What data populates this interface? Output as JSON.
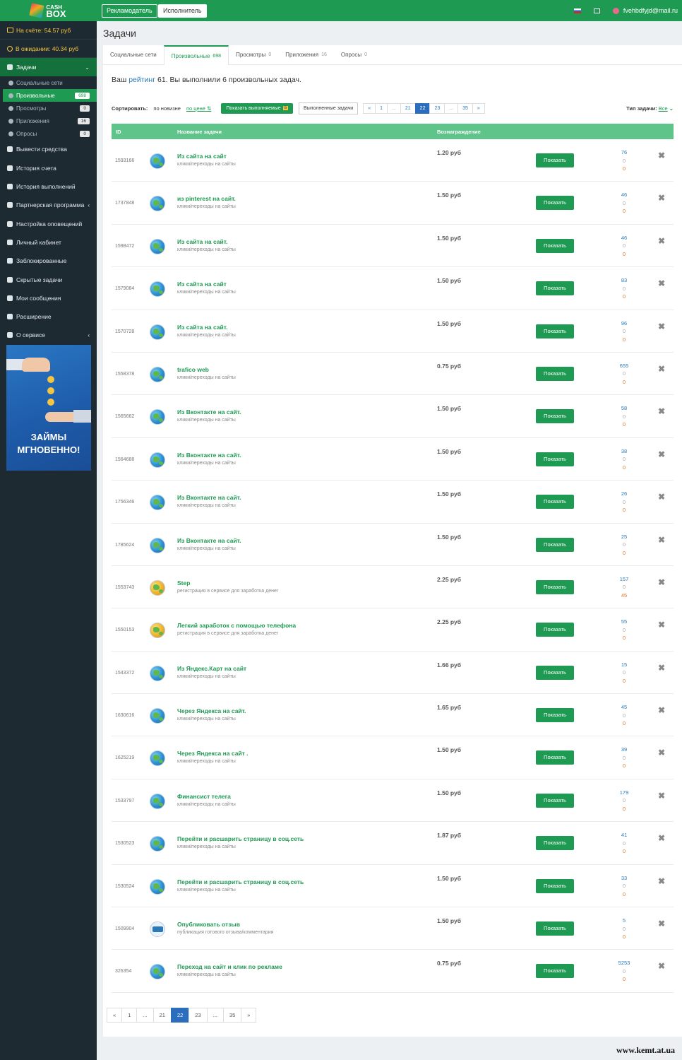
{
  "logo": {
    "line1": "CASH",
    "line2": "BOX"
  },
  "header": {
    "advertiser_label": "Рекламодатель",
    "executor_label": "Исполнитель",
    "user_email": "fvehbdfyjd@mail.ru"
  },
  "sidebar": {
    "balance": "На счёте: 54.57 руб",
    "pending": "В ожидании: 40.34 руб",
    "tasks_label": "Задачи",
    "sub_items": [
      {
        "label": "Социальные сети",
        "badge": ""
      },
      {
        "label": "Произвольные",
        "badge": "698"
      },
      {
        "label": "Просмотры",
        "badge": "0"
      },
      {
        "label": "Приложения",
        "badge": "16"
      },
      {
        "label": "Опросы",
        "badge": "0"
      }
    ],
    "items": [
      "Вывести средства",
      "История счета",
      "История выполнений",
      "Партнерская программа",
      "Настройка оповещений",
      "Личный кабинет",
      "Заблокированные",
      "Скрытые задачи",
      "Мои сообщения",
      "Расширение",
      "О сервисе"
    ],
    "banner_text_1": "ЗАЙМЫ",
    "banner_text_2": "МГНОВЕННО!"
  },
  "page": {
    "title": "Задачи"
  },
  "tabs": [
    {
      "label": "Социальные сети",
      "count": ""
    },
    {
      "label": "Произвольные",
      "count": "698"
    },
    {
      "label": "Просмотры",
      "count": "0"
    },
    {
      "label": "Приложения",
      "count": "16"
    },
    {
      "label": "Опросы",
      "count": "0"
    }
  ],
  "rating": {
    "prefix": "Ваш",
    "link": "рейтинг",
    "suffix": "61. Вы выполнили 6 произвольных задач."
  },
  "controls": {
    "sort_label": "Сортировать:",
    "sort_new": "по новизне",
    "sort_price": "по цене",
    "show_done_label": "Показать выполняемые",
    "show_done_badge": "6",
    "completed_label": "Выполненные задачи",
    "task_type_label": "Тип задачи:",
    "task_type_value": "Все"
  },
  "pagination": [
    "«",
    "1",
    "...",
    "21",
    "22",
    "23",
    "...",
    "35",
    "»"
  ],
  "pagination_current": "22",
  "table": {
    "headers": {
      "id": "ID",
      "name": "Название задачи",
      "reward": "Вознаграждение"
    },
    "show_label": "Показать",
    "rows": [
      {
        "id": "1593166",
        "title": "Из сайта на сайт",
        "cat": "клики/переходы на сайты",
        "price": "1.20 руб",
        "s1": "76",
        "s2": "0",
        "s3": "0",
        "icon": "globe"
      },
      {
        "id": "1737848",
        "title": "из pinterest на сайт.",
        "cat": "клики/переходы на сайты",
        "price": "1.50 руб",
        "s1": "46",
        "s2": "0",
        "s3": "0",
        "icon": "globe"
      },
      {
        "id": "1598472",
        "title": "Из сайта на сайт.",
        "cat": "клики/переходы на сайты",
        "price": "1.50 руб",
        "s1": "46",
        "s2": "0",
        "s3": "0",
        "icon": "globe"
      },
      {
        "id": "1579084",
        "title": "Из сайта на сайт",
        "cat": "клики/переходы на сайты",
        "price": "1.50 руб",
        "s1": "83",
        "s2": "0",
        "s3": "0",
        "icon": "globe"
      },
      {
        "id": "1570728",
        "title": "Из сайта на сайт.",
        "cat": "клики/переходы на сайты",
        "price": "1.50 руб",
        "s1": "96",
        "s2": "0",
        "s3": "0",
        "icon": "globe"
      },
      {
        "id": "1558378",
        "title": "trafico web",
        "cat": "клики/переходы на сайты",
        "price": "0.75 руб",
        "s1": "655",
        "s2": "0",
        "s3": "0",
        "icon": "globe"
      },
      {
        "id": "1565662",
        "title": "Из Вконтакте на сайт.",
        "cat": "клики/переходы на сайты",
        "price": "1.50 руб",
        "s1": "58",
        "s2": "0",
        "s3": "0",
        "icon": "globe"
      },
      {
        "id": "1564688",
        "title": "Из Вконтакте на сайт.",
        "cat": "клики/переходы на сайты",
        "price": "1.50 руб",
        "s1": "38",
        "s2": "0",
        "s3": "0",
        "icon": "globe"
      },
      {
        "id": "1756346",
        "title": "Из Вконтакте на сайт.",
        "cat": "клики/переходы на сайты",
        "price": "1.50 руб",
        "s1": "26",
        "s2": "0",
        "s3": "0",
        "icon": "globe"
      },
      {
        "id": "1785624",
        "title": "Из Вконтакте на сайт.",
        "cat": "клики/переходы на сайты",
        "price": "1.50 руб",
        "s1": "25",
        "s2": "0",
        "s3": "0",
        "icon": "globe"
      },
      {
        "id": "1553743",
        "title": "Step",
        "cat": "регистрация в сервисе для заработка денег",
        "price": "2.25 руб",
        "s1": "157",
        "s2": "0",
        "s3": "45",
        "icon": "reg"
      },
      {
        "id": "1550153",
        "title": "Легкий заработок с помощью телефона",
        "cat": "регистрация в сервисе для заработка денег",
        "price": "2.25 руб",
        "s1": "55",
        "s2": "0",
        "s3": "0",
        "icon": "reg"
      },
      {
        "id": "1543372",
        "title": "Из Яндекс.Карт на сайт",
        "cat": "клики/переходы на сайты",
        "price": "1.66 руб",
        "s1": "15",
        "s2": "0",
        "s3": "0",
        "icon": "globe"
      },
      {
        "id": "1630616",
        "title": "Через Яндекса на сайт.",
        "cat": "клики/переходы на сайты",
        "price": "1.65 руб",
        "s1": "45",
        "s2": "0",
        "s3": "0",
        "icon": "globe"
      },
      {
        "id": "1625219",
        "title": "Через Яндекса на сайт .",
        "cat": "клики/переходы на сайты",
        "price": "1.50 руб",
        "s1": "39",
        "s2": "0",
        "s3": "0",
        "icon": "globe"
      },
      {
        "id": "1533797",
        "title": "Финансист телега",
        "cat": "клики/переходы на сайты",
        "price": "1.50 руб",
        "s1": "179",
        "s2": "0",
        "s3": "0",
        "icon": "globe"
      },
      {
        "id": "1530523",
        "title": "Перейти и расшарить страницу в соц.сеть",
        "cat": "клики/переходы на сайты",
        "price": "1.87 руб",
        "s1": "41",
        "s2": "0",
        "s3": "0",
        "icon": "globe"
      },
      {
        "id": "1530524",
        "title": "Перейти и расшарить страницу в соц.сеть",
        "cat": "клики/переходы на сайты",
        "price": "1.50 руб",
        "s1": "33",
        "s2": "0",
        "s3": "0",
        "icon": "globe"
      },
      {
        "id": "1509904",
        "title": "Опубликовать отзыв",
        "cat": "публикация готового отзыва/комментария",
        "price": "1.50 руб",
        "s1": "5",
        "s2": "0",
        "s3": "0",
        "icon": "rev"
      },
      {
        "id": "326354",
        "title": "Переход на сайт и клик по рекламе",
        "cat": "клики/переходы на сайты",
        "price": "0.75 руб",
        "s1": "5253",
        "s2": "0",
        "s3": "0",
        "icon": "globe"
      }
    ]
  },
  "watermark": "www.kemt.at.ua",
  "colors": {
    "brand_green": "#1f9a53",
    "sidebar_bg": "#1e2a32",
    "header_row": "#5ec48a",
    "page_active": "#2a6ebd",
    "balance_yellow": "#f4c542"
  }
}
